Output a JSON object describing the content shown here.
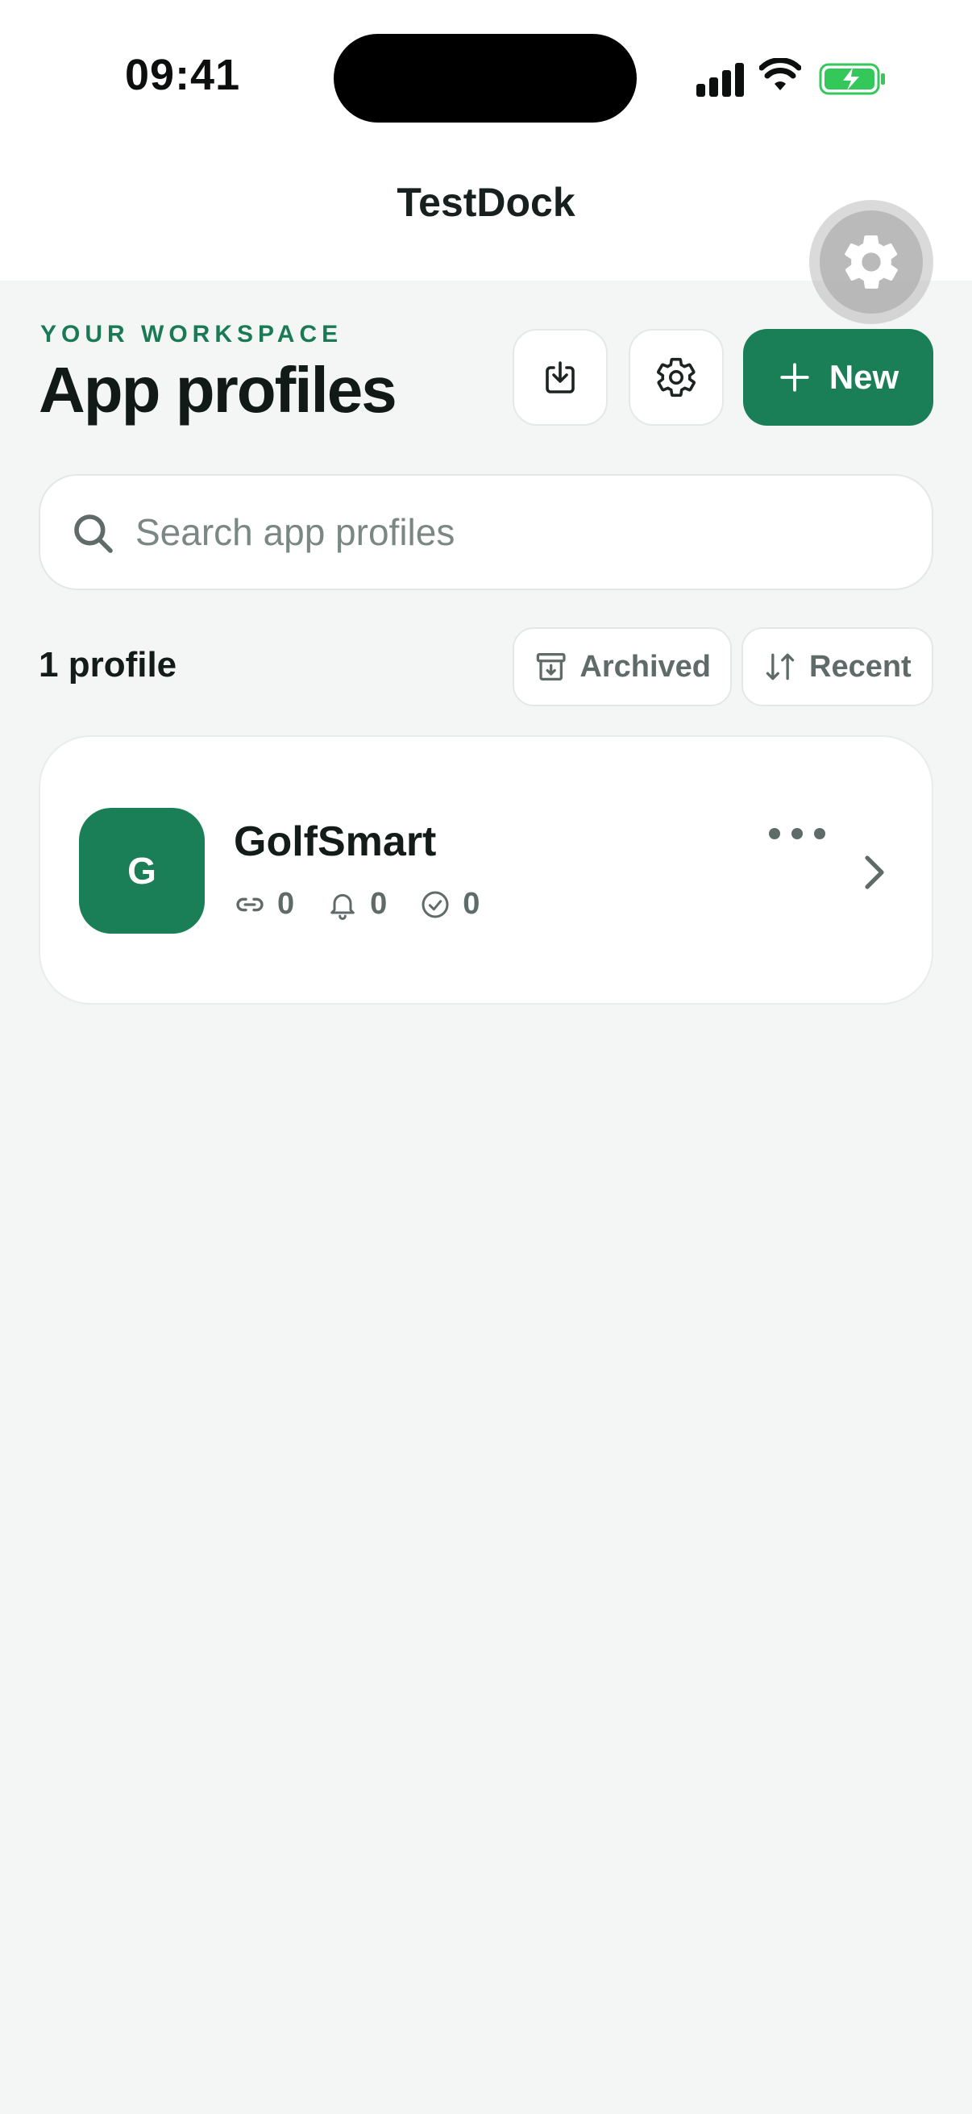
{
  "status_bar": {
    "time": "09:41"
  },
  "nav": {
    "title": "TestDock"
  },
  "header": {
    "eyebrow": "YOUR WORKSPACE",
    "title": "App profiles",
    "new_label": "New"
  },
  "search": {
    "placeholder": "Search app profiles",
    "value": ""
  },
  "list": {
    "count_label": "1 profile",
    "filter_archived": "Archived",
    "sort_recent": "Recent",
    "profiles": [
      {
        "initial": "G",
        "name": "GolfSmart",
        "links": "0",
        "notifications": "0",
        "checks": "0"
      }
    ]
  },
  "colors": {
    "accent": "#1a7f57",
    "eyebrow": "#1a7a55",
    "background": "#f4f6f5",
    "battery": "#34c759"
  },
  "icons": [
    "signal-icon",
    "wifi-icon",
    "battery-icon",
    "gear-icon",
    "import-icon",
    "settings-icon",
    "plus-icon",
    "search-icon",
    "archive-icon",
    "sort-icon",
    "link-icon",
    "bell-icon",
    "check-circle-icon",
    "more-icon",
    "chevron-right-icon"
  ]
}
